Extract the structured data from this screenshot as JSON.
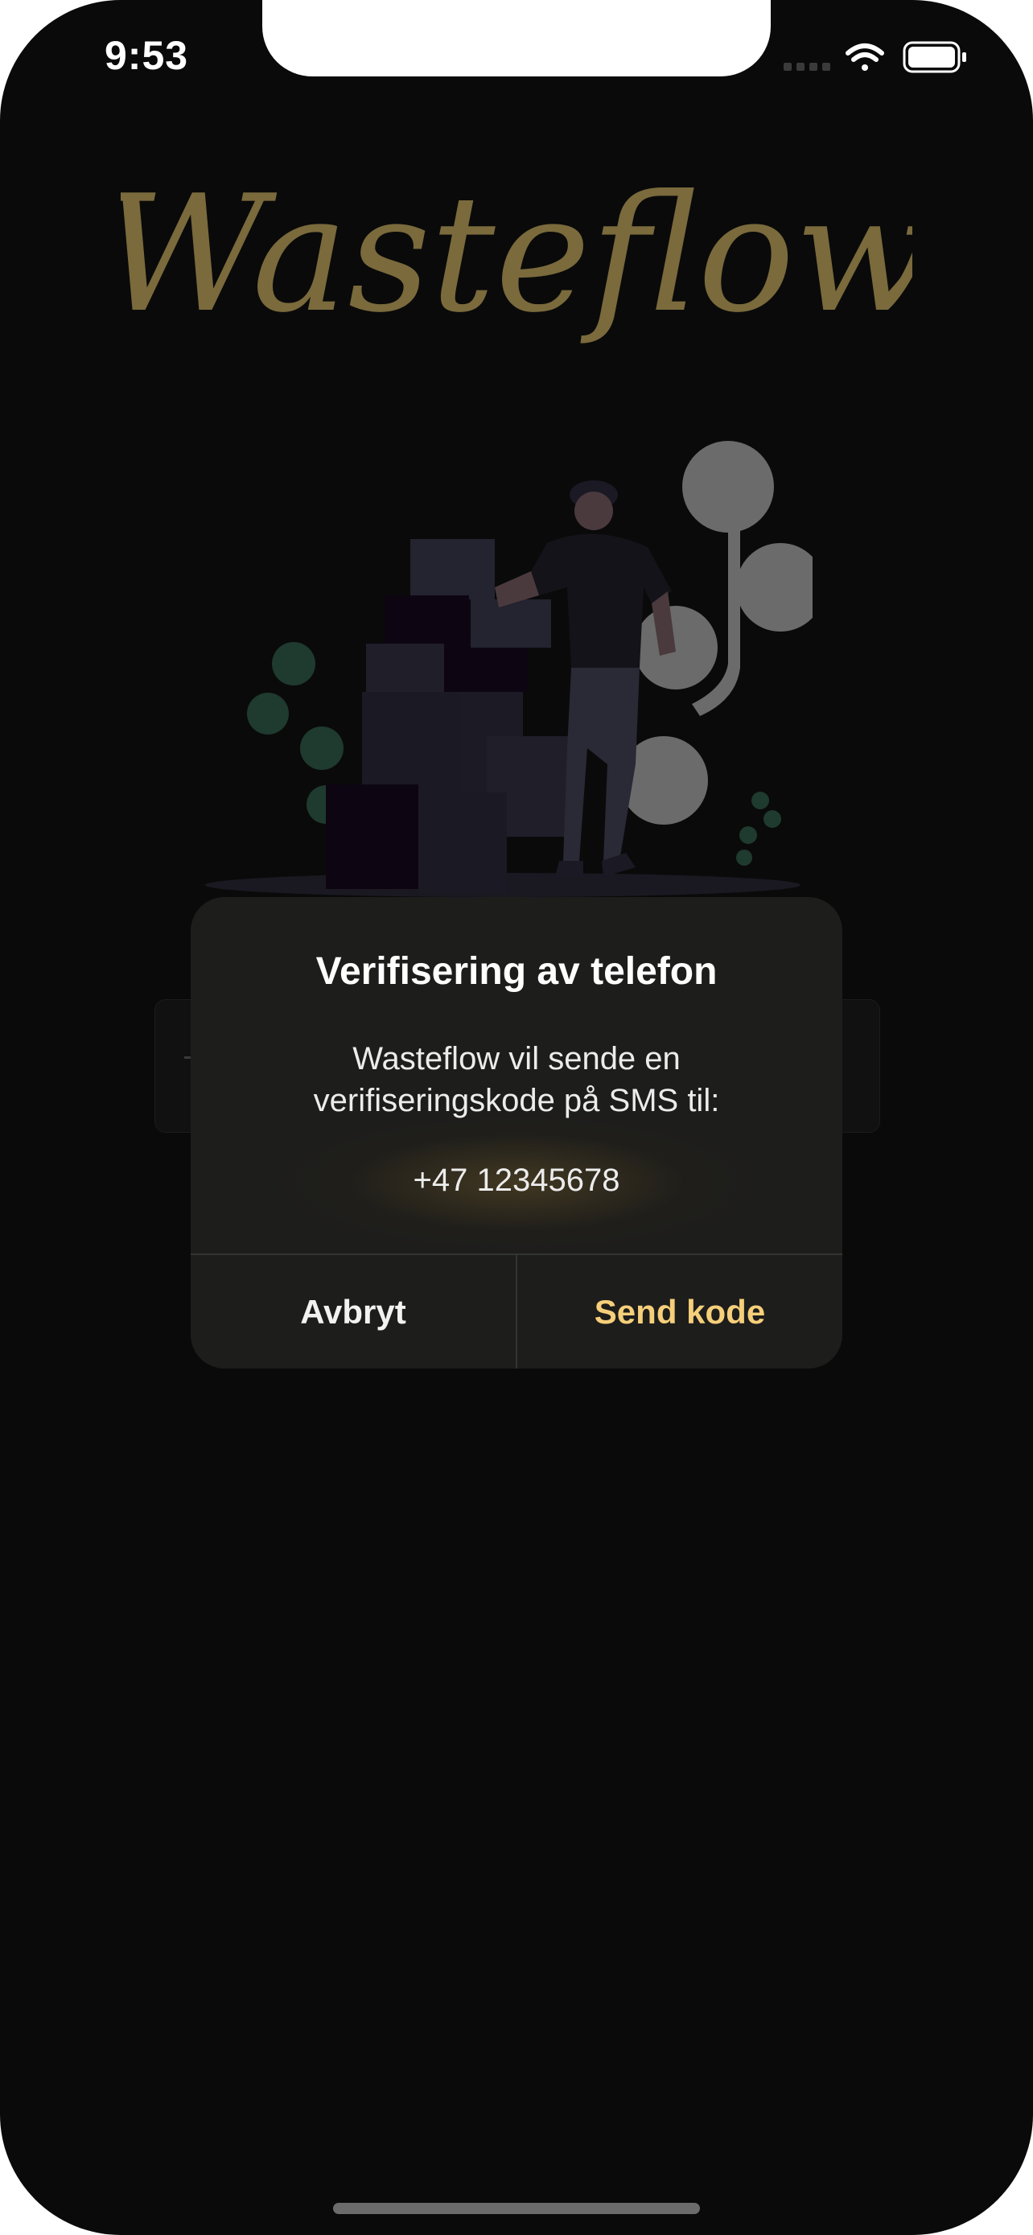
{
  "status_bar": {
    "time": "9:53",
    "icons": [
      "cellular-signal-icon",
      "wifi-icon",
      "battery-icon"
    ]
  },
  "logo": {
    "text": "Wasteflow",
    "color": "#7a6a3c"
  },
  "illustration": {
    "icon": "person-with-boxes-illustration"
  },
  "dialog": {
    "title": "Verifisering av telefon",
    "message_line1": "Wasteflow vil sende en",
    "message_line2": "verifiseringskode på SMS til:",
    "phone_number": "+47 12345678",
    "cancel_label": "Avbryt",
    "confirm_label": "Send kode"
  },
  "colors": {
    "background": "#0a0a0a",
    "dialog_background": "#1d1d1c",
    "accent": "#f5cf7a"
  }
}
